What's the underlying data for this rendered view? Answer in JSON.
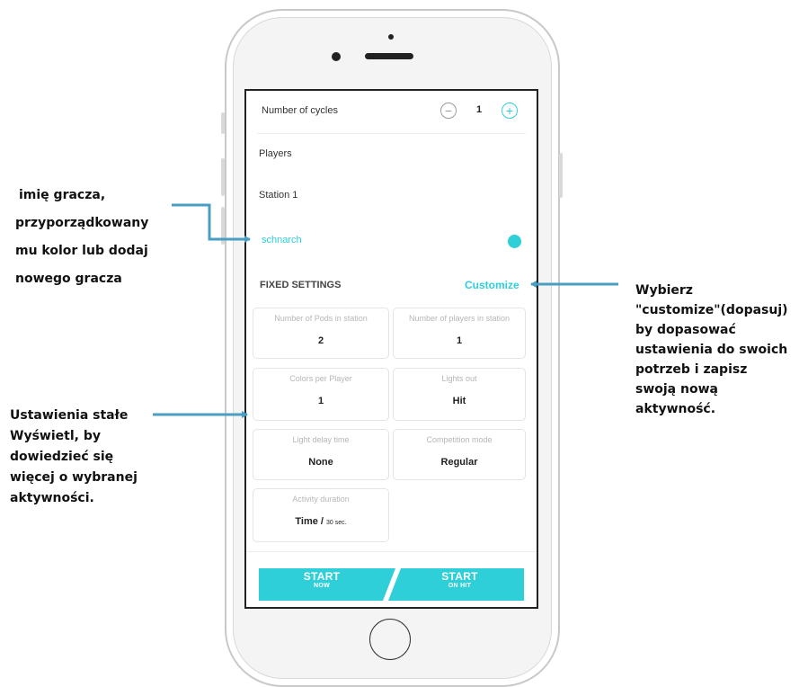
{
  "colors": {
    "accent": "#2ecfd8",
    "callout_line": "#4a9ec2",
    "text_dark": "#222222",
    "muted": "#b6b6b6"
  },
  "annotations": {
    "player": [
      "imię gracza,",
      "przyporządkowany",
      "mu kolor  lub dodaj",
      "nowego gracza"
    ],
    "customize": [
      "Wybierz",
      "\"customize\"(dopasuj)",
      "by dopasować",
      "ustawienia do swoich",
      "potrzeb i zapisz",
      "swoją nową",
      "aktywność."
    ],
    "fixed": [
      "Ustawienia stałe",
      "Wyświetl, by",
      "dowiedzieć się",
      "więcej o wybranej",
      "aktywności."
    ]
  },
  "cycles": {
    "label": "Number of cycles",
    "value": "1",
    "minus_icon": "minus-circle-icon",
    "plus_icon": "plus-circle-icon"
  },
  "players": {
    "label": "Players",
    "station_label": "Station 1",
    "player_name": "schnarch",
    "player_color": "#2ecfd8"
  },
  "fixed_settings": {
    "title": "FIXED SETTINGS",
    "customize_label": "Customize",
    "cards": [
      {
        "label": "Number of Pods in station",
        "value": "2"
      },
      {
        "label": "Number of players in station",
        "value": "1"
      },
      {
        "label": "Colors per Player",
        "value": "1"
      },
      {
        "label": "Lights out",
        "value": "Hit"
      },
      {
        "label": "Light delay time",
        "value": "None"
      },
      {
        "label": "Competition mode",
        "value": "Regular"
      },
      {
        "label": "Activity duration",
        "value": "Time / ",
        "unit": "30 sec."
      }
    ]
  },
  "buttons": {
    "start_now": {
      "main": "START",
      "sub": "NOW"
    },
    "start_on_hit": {
      "main": "START",
      "sub": "ON HIT"
    }
  }
}
